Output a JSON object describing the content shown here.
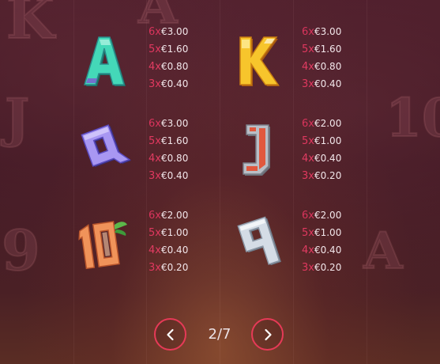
{
  "paytable": {
    "symbols": [
      {
        "name": "A",
        "icon": "letter-a-symbol-icon",
        "color": "#3fd2b4",
        "pays": [
          {
            "count": "6x",
            "value": "€3.00"
          },
          {
            "count": "5x",
            "value": "€1.60"
          },
          {
            "count": "4x",
            "value": "€0.80"
          },
          {
            "count": "3x",
            "value": "€0.40"
          }
        ]
      },
      {
        "name": "K",
        "icon": "letter-k-symbol-icon",
        "color": "#f5c02a",
        "pays": [
          {
            "count": "6x",
            "value": "€3.00"
          },
          {
            "count": "5x",
            "value": "€1.60"
          },
          {
            "count": "4x",
            "value": "€0.80"
          },
          {
            "count": "3x",
            "value": "€0.40"
          }
        ]
      },
      {
        "name": "Q",
        "icon": "letter-q-symbol-icon",
        "color": "#9a8cf0",
        "pays": [
          {
            "count": "6x",
            "value": "€3.00"
          },
          {
            "count": "5x",
            "value": "€1.60"
          },
          {
            "count": "4x",
            "value": "€0.80"
          },
          {
            "count": "3x",
            "value": "€0.40"
          }
        ]
      },
      {
        "name": "J",
        "icon": "letter-j-symbol-icon",
        "color": "#e05a4a",
        "pays": [
          {
            "count": "6x",
            "value": "€2.00"
          },
          {
            "count": "5x",
            "value": "€1.00"
          },
          {
            "count": "4x",
            "value": "€0.40"
          },
          {
            "count": "3x",
            "value": "€0.20"
          }
        ]
      },
      {
        "name": "10",
        "icon": "number-ten-symbol-icon",
        "color": "#f0935a",
        "pays": [
          {
            "count": "6x",
            "value": "€2.00"
          },
          {
            "count": "5x",
            "value": "€1.00"
          },
          {
            "count": "4x",
            "value": "€0.40"
          },
          {
            "count": "3x",
            "value": "€0.20"
          }
        ]
      },
      {
        "name": "9",
        "icon": "number-nine-symbol-icon",
        "color": "#c9d3de",
        "pays": [
          {
            "count": "6x",
            "value": "€2.00"
          },
          {
            "count": "5x",
            "value": "€1.00"
          },
          {
            "count": "4x",
            "value": "€0.40"
          },
          {
            "count": "3x",
            "value": "€0.20"
          }
        ]
      }
    ]
  },
  "pagination": {
    "current": "2/7",
    "prev_icon": "chevron-left-icon",
    "next_icon": "chevron-right-icon",
    "accent": "#e63a57"
  }
}
